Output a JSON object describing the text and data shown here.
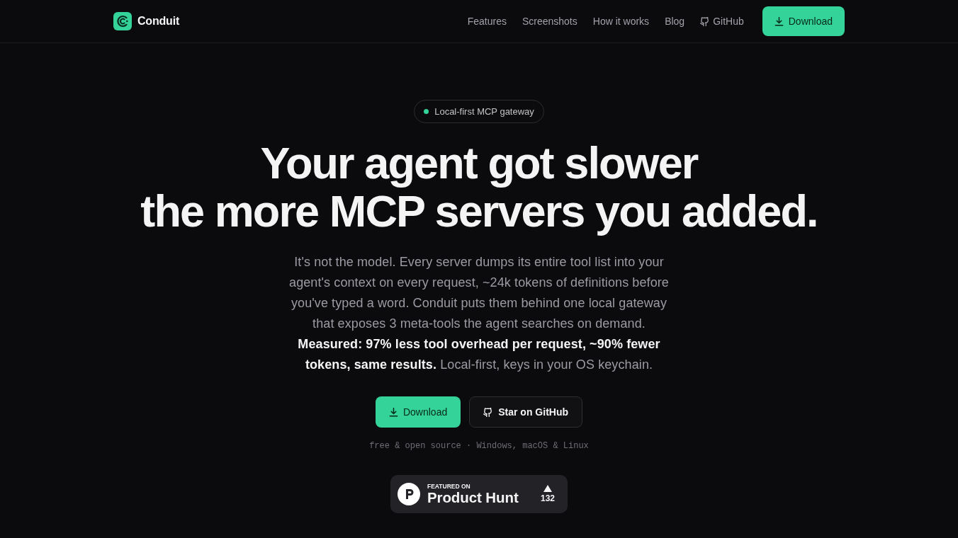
{
  "navbar": {
    "brand": "Conduit",
    "links": [
      {
        "label": "Features",
        "kind": "text"
      },
      {
        "label": "Screenshots",
        "kind": "text"
      },
      {
        "label": "How it works",
        "kind": "text"
      },
      {
        "label": "Blog",
        "kind": "text"
      },
      {
        "label": "GitHub",
        "kind": "github"
      }
    ],
    "cta": {
      "label": "Download"
    }
  },
  "hero": {
    "badge": {
      "label": "Local-first MCP gateway"
    },
    "headline": [
      "Your agent got slower",
      "the more MCP servers you added."
    ],
    "description": "It's not the model. Every server dumps its entire tool list into your agent's context on every request, ~24k tokens of definitions before you've typed a word. Conduit puts them behind one local gateway that exposes 3 meta-tools the agent searches on demand. **Measured: 97% less tool overhead per request, ~90% fewer tokens, same results.** Local-first, keys in your OS keychain.",
    "buttons": [
      {
        "label": "Download",
        "kind": "primary"
      },
      {
        "label": "Star on GitHub",
        "kind": "outline"
      }
    ],
    "note": "free & open source · Windows, macOS & Linux",
    "product_hunt": {
      "eyebrow": "FEATURED ON",
      "name": "Product Hunt",
      "count": "132"
    }
  }
}
